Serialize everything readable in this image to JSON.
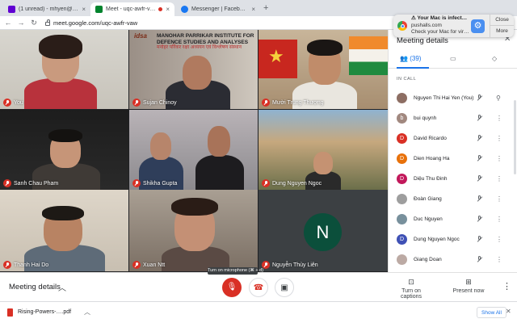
{
  "browser": {
    "tabs": [
      {
        "label": "(1 unread) - mhyen@yahoo.com",
        "favicon_color": "#6001d2",
        "active": false
      },
      {
        "label": "Meet - uqc-awfr-vaw",
        "favicon_color": "#00832d",
        "active": true,
        "recording": true
      },
      {
        "label": "Messenger | Facebook",
        "favicon_color": "#1877f2",
        "active": false
      }
    ],
    "new_tab": "+",
    "url": "meet.google.com/uqc-awfr-vaw"
  },
  "notification": {
    "title": "⚠ Your Mac is infect…",
    "source": "pushalls.com",
    "body": "Check your Mac for vir…",
    "close_label": "Close",
    "more_label": "More"
  },
  "tiles": [
    {
      "name": "You",
      "muted": true
    },
    {
      "name": "Sujan Chinoy",
      "muted": true
    },
    {
      "name": "Mười Trung Thượng",
      "muted": true
    },
    {
      "name": "Sanh Chau Pham",
      "muted": true
    },
    {
      "name": "Shikha Gupta",
      "muted": true
    },
    {
      "name": "Dung Nguyen Ngoc",
      "muted": true
    },
    {
      "name": "Thanh Hai Do",
      "muted": true
    },
    {
      "name": "Xuan Ntt",
      "muted": true
    },
    {
      "name": "Nguyễn Thùy Liên",
      "muted": true,
      "initial": "N"
    }
  ],
  "banner": {
    "logo": "idsa",
    "line1": "MANOHAR PARRIKAR INSTITUTE FOR",
    "line2": "DEFENCE STUDIES AND ANALYSES",
    "hindi": "मनोहर पर्रिकर रक्षा अध्ययन एवं विश्लेषण संस्थान"
  },
  "bottom": {
    "meeting_details": "Meeting details",
    "tooltip": "Turn on microphone (⌘ + d)",
    "captions": "Turn on captions",
    "present": "Present now"
  },
  "panel": {
    "title": "Meeting details",
    "people_count": "(39)",
    "section_label": "IN CALL",
    "participants": [
      {
        "name": "Nguyen Thi Hai Yen (You)",
        "initial": "",
        "color": "#8d6e63"
      },
      {
        "name": "bui quynh",
        "initial": "b",
        "color": "#a1887f"
      },
      {
        "name": "David Ricardo",
        "initial": "D",
        "color": "#d93025"
      },
      {
        "name": "Dien Hoang Ha",
        "initial": "D",
        "color": "#e8710a"
      },
      {
        "name": "Diệu Thu Đinh",
        "initial": "D",
        "color": "#c2185b"
      },
      {
        "name": "Đoàn Giang",
        "initial": "",
        "color": "#9e9e9e"
      },
      {
        "name": "Duc Nguyen",
        "initial": "",
        "color": "#78909c"
      },
      {
        "name": "Dung Nguyen Ngoc",
        "initial": "D",
        "color": "#3f51b5"
      },
      {
        "name": "Giang Doan",
        "initial": "",
        "color": "#bcaaa4"
      }
    ]
  },
  "downloads": {
    "file": "Rising-Powers-….pdf",
    "show_all": "Show All"
  }
}
